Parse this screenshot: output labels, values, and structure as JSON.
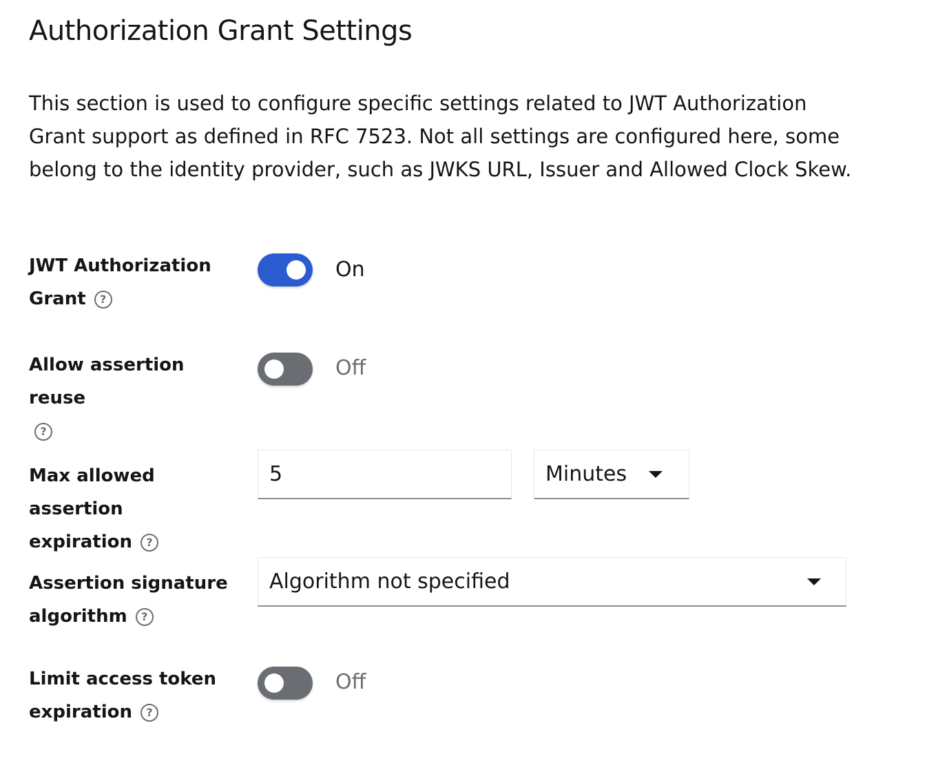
{
  "section": {
    "title": "Authorization Grant Settings",
    "description": "This section is used to configure specific settings related to JWT Authorization Grant support as defined in RFC 7523. Not all settings are configured here, some belong to the identity provider, such as JWKS URL, Issuer and Allowed Clock Skew."
  },
  "fields": {
    "jwt_grant": {
      "label_line1": "JWT Authorization",
      "label_line2": "Grant",
      "state_text": "On"
    },
    "assertion_reuse": {
      "label_line1": "Allow assertion reuse",
      "state_text": "Off"
    },
    "max_expiration": {
      "label_line1": "Max allowed assertion",
      "label_line2": "expiration",
      "value": "5",
      "unit": "Minutes"
    },
    "signature_algorithm": {
      "label_line1": "Assertion signature",
      "label_line2": "algorithm",
      "value": "Algorithm not specified"
    },
    "limit_token_expiration": {
      "label_line1": "Limit access token",
      "label_line2": "expiration",
      "state_text": "Off"
    }
  },
  "icons": {
    "help": "?"
  },
  "colors": {
    "toggle_on": "#2b5ccf",
    "toggle_off": "#6a6e73",
    "text": "#151515",
    "muted_text": "#6a6e73"
  }
}
